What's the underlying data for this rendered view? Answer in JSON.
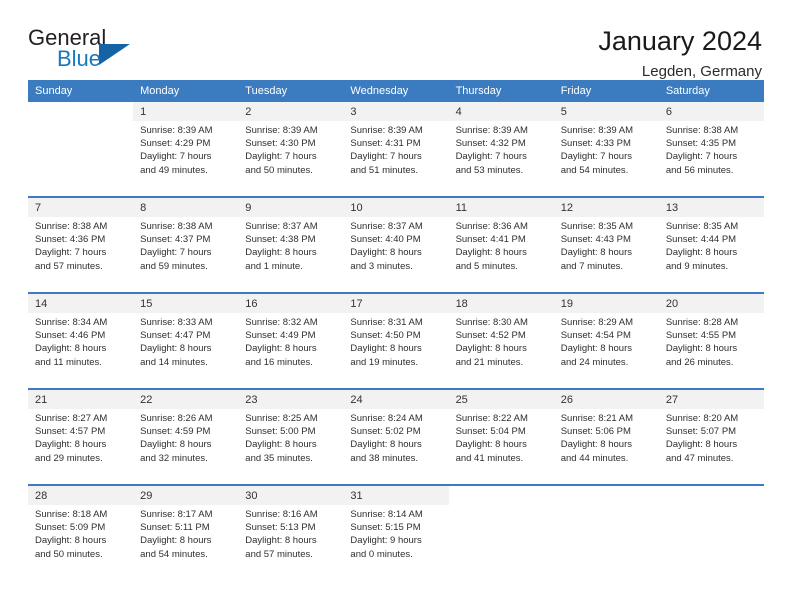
{
  "brand": {
    "name_top": "General",
    "name_bottom": "Blue",
    "accent_color": "#1878be",
    "triangle_color": "#1464a5"
  },
  "header": {
    "title": "January 2024",
    "location": "Legden, Germany"
  },
  "calendar": {
    "header_color": "#3b7cc0",
    "weekdays": [
      "Sunday",
      "Monday",
      "Tuesday",
      "Wednesday",
      "Thursday",
      "Friday",
      "Saturday"
    ],
    "weeks": [
      [
        {
          "day": "",
          "lines": []
        },
        {
          "day": "1",
          "lines": [
            "Sunrise: 8:39 AM",
            "Sunset: 4:29 PM",
            "Daylight: 7 hours",
            "and 49 minutes."
          ]
        },
        {
          "day": "2",
          "lines": [
            "Sunrise: 8:39 AM",
            "Sunset: 4:30 PM",
            "Daylight: 7 hours",
            "and 50 minutes."
          ]
        },
        {
          "day": "3",
          "lines": [
            "Sunrise: 8:39 AM",
            "Sunset: 4:31 PM",
            "Daylight: 7 hours",
            "and 51 minutes."
          ]
        },
        {
          "day": "4",
          "lines": [
            "Sunrise: 8:39 AM",
            "Sunset: 4:32 PM",
            "Daylight: 7 hours",
            "and 53 minutes."
          ]
        },
        {
          "day": "5",
          "lines": [
            "Sunrise: 8:39 AM",
            "Sunset: 4:33 PM",
            "Daylight: 7 hours",
            "and 54 minutes."
          ]
        },
        {
          "day": "6",
          "lines": [
            "Sunrise: 8:38 AM",
            "Sunset: 4:35 PM",
            "Daylight: 7 hours",
            "and 56 minutes."
          ]
        }
      ],
      [
        {
          "day": "7",
          "lines": [
            "Sunrise: 8:38 AM",
            "Sunset: 4:36 PM",
            "Daylight: 7 hours",
            "and 57 minutes."
          ]
        },
        {
          "day": "8",
          "lines": [
            "Sunrise: 8:38 AM",
            "Sunset: 4:37 PM",
            "Daylight: 7 hours",
            "and 59 minutes."
          ]
        },
        {
          "day": "9",
          "lines": [
            "Sunrise: 8:37 AM",
            "Sunset: 4:38 PM",
            "Daylight: 8 hours",
            "and 1 minute."
          ]
        },
        {
          "day": "10",
          "lines": [
            "Sunrise: 8:37 AM",
            "Sunset: 4:40 PM",
            "Daylight: 8 hours",
            "and 3 minutes."
          ]
        },
        {
          "day": "11",
          "lines": [
            "Sunrise: 8:36 AM",
            "Sunset: 4:41 PM",
            "Daylight: 8 hours",
            "and 5 minutes."
          ]
        },
        {
          "day": "12",
          "lines": [
            "Sunrise: 8:35 AM",
            "Sunset: 4:43 PM",
            "Daylight: 8 hours",
            "and 7 minutes."
          ]
        },
        {
          "day": "13",
          "lines": [
            "Sunrise: 8:35 AM",
            "Sunset: 4:44 PM",
            "Daylight: 8 hours",
            "and 9 minutes."
          ]
        }
      ],
      [
        {
          "day": "14",
          "lines": [
            "Sunrise: 8:34 AM",
            "Sunset: 4:46 PM",
            "Daylight: 8 hours",
            "and 11 minutes."
          ]
        },
        {
          "day": "15",
          "lines": [
            "Sunrise: 8:33 AM",
            "Sunset: 4:47 PM",
            "Daylight: 8 hours",
            "and 14 minutes."
          ]
        },
        {
          "day": "16",
          "lines": [
            "Sunrise: 8:32 AM",
            "Sunset: 4:49 PM",
            "Daylight: 8 hours",
            "and 16 minutes."
          ]
        },
        {
          "day": "17",
          "lines": [
            "Sunrise: 8:31 AM",
            "Sunset: 4:50 PM",
            "Daylight: 8 hours",
            "and 19 minutes."
          ]
        },
        {
          "day": "18",
          "lines": [
            "Sunrise: 8:30 AM",
            "Sunset: 4:52 PM",
            "Daylight: 8 hours",
            "and 21 minutes."
          ]
        },
        {
          "day": "19",
          "lines": [
            "Sunrise: 8:29 AM",
            "Sunset: 4:54 PM",
            "Daylight: 8 hours",
            "and 24 minutes."
          ]
        },
        {
          "day": "20",
          "lines": [
            "Sunrise: 8:28 AM",
            "Sunset: 4:55 PM",
            "Daylight: 8 hours",
            "and 26 minutes."
          ]
        }
      ],
      [
        {
          "day": "21",
          "lines": [
            "Sunrise: 8:27 AM",
            "Sunset: 4:57 PM",
            "Daylight: 8 hours",
            "and 29 minutes."
          ]
        },
        {
          "day": "22",
          "lines": [
            "Sunrise: 8:26 AM",
            "Sunset: 4:59 PM",
            "Daylight: 8 hours",
            "and 32 minutes."
          ]
        },
        {
          "day": "23",
          "lines": [
            "Sunrise: 8:25 AM",
            "Sunset: 5:00 PM",
            "Daylight: 8 hours",
            "and 35 minutes."
          ]
        },
        {
          "day": "24",
          "lines": [
            "Sunrise: 8:24 AM",
            "Sunset: 5:02 PM",
            "Daylight: 8 hours",
            "and 38 minutes."
          ]
        },
        {
          "day": "25",
          "lines": [
            "Sunrise: 8:22 AM",
            "Sunset: 5:04 PM",
            "Daylight: 8 hours",
            "and 41 minutes."
          ]
        },
        {
          "day": "26",
          "lines": [
            "Sunrise: 8:21 AM",
            "Sunset: 5:06 PM",
            "Daylight: 8 hours",
            "and 44 minutes."
          ]
        },
        {
          "day": "27",
          "lines": [
            "Sunrise: 8:20 AM",
            "Sunset: 5:07 PM",
            "Daylight: 8 hours",
            "and 47 minutes."
          ]
        }
      ],
      [
        {
          "day": "28",
          "lines": [
            "Sunrise: 8:18 AM",
            "Sunset: 5:09 PM",
            "Daylight: 8 hours",
            "and 50 minutes."
          ]
        },
        {
          "day": "29",
          "lines": [
            "Sunrise: 8:17 AM",
            "Sunset: 5:11 PM",
            "Daylight: 8 hours",
            "and 54 minutes."
          ]
        },
        {
          "day": "30",
          "lines": [
            "Sunrise: 8:16 AM",
            "Sunset: 5:13 PM",
            "Daylight: 8 hours",
            "and 57 minutes."
          ]
        },
        {
          "day": "31",
          "lines": [
            "Sunrise: 8:14 AM",
            "Sunset: 5:15 PM",
            "Daylight: 9 hours",
            "and 0 minutes."
          ]
        },
        {
          "day": "",
          "lines": []
        },
        {
          "day": "",
          "lines": []
        },
        {
          "day": "",
          "lines": []
        }
      ]
    ]
  }
}
